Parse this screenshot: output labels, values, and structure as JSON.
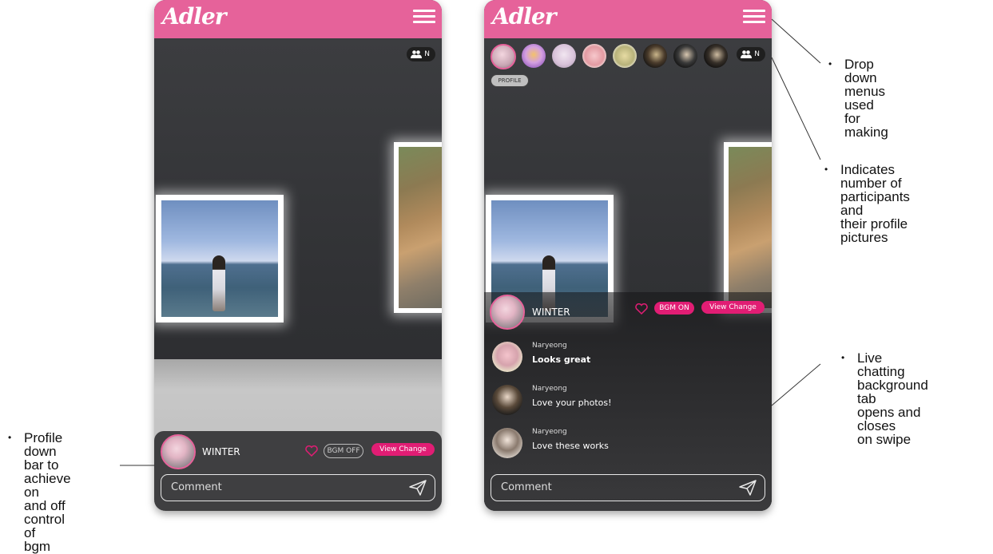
{
  "app": {
    "logo": "Adler"
  },
  "phone_left": {
    "participants_count": "N",
    "profile_bar": {
      "username": "WINTER",
      "bgm_label": "BGM OFF",
      "view_change_label": "View Change",
      "comment_placeholder": "Comment"
    }
  },
  "phone_right": {
    "participants_count": "N",
    "profile_tag": "PROFILE",
    "profile_bar": {
      "username": "WINTER",
      "bgm_label": "BGM ON",
      "view_change_label": "View Change",
      "comment_placeholder": "Comment"
    },
    "chat": [
      {
        "name": "Naryeong",
        "message": "Looks great"
      },
      {
        "name": "Naryeong",
        "message": "Love your photos!"
      },
      {
        "name": "Naryeong",
        "message": "Love these works"
      }
    ]
  },
  "annotations": {
    "menus": "Drop down\nmenus used for\nmaking",
    "participants": "Indicates number of\nparticipants and\ntheir profile pictures",
    "chat": "Live chatting\nbackground tab\nopens and closes\non swipe",
    "profile_bar": "Profile down\nbar to\nachieve on\nand off\ncontrol of\nbgm"
  },
  "colors": {
    "brand_pink": "#e6629a",
    "accent_magenta": "#e11d74",
    "panel_dark": "#3f3f41"
  },
  "icons": [
    "menu-icon",
    "participants-icon",
    "heart-icon",
    "send-icon"
  ]
}
